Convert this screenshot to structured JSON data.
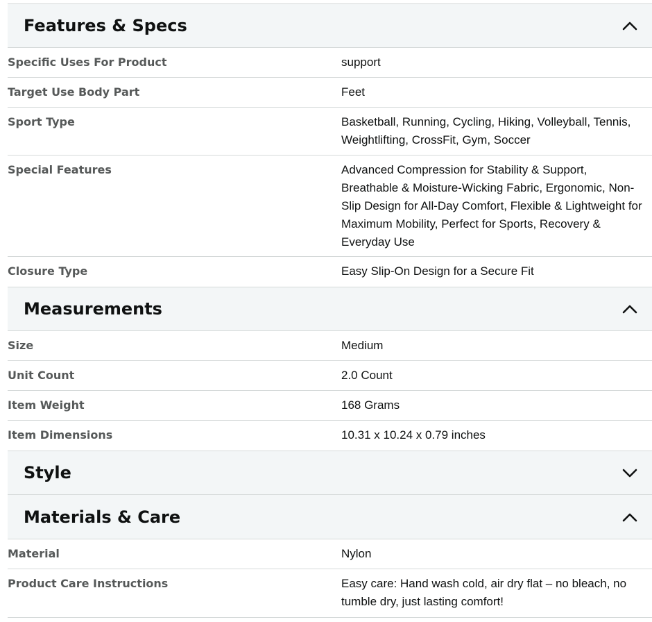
{
  "sections": [
    {
      "title": "Features & Specs",
      "expanded": true,
      "rows": [
        {
          "label": "Specific Uses For Product",
          "value": "support"
        },
        {
          "label": "Target Use Body Part",
          "value": "Feet"
        },
        {
          "label": "Sport Type",
          "value": "Basketball, Running, Cycling, Hiking, Volleyball, Tennis, Weightlifting, CrossFit, Gym, Soccer"
        },
        {
          "label": "Special Features",
          "value": "Advanced Compression for Stability & Support, Breathable & Moisture-Wicking Fabric, Ergonomic, Non-Slip Design for All-Day Comfort, Flexible & Lightweight for Maximum Mobility, Perfect for Sports, Recovery & Everyday Use"
        },
        {
          "label": "Closure Type",
          "value": "Easy Slip-On Design for a Secure Fit"
        }
      ]
    },
    {
      "title": "Measurements",
      "expanded": true,
      "rows": [
        {
          "label": "Size",
          "value": "Medium"
        },
        {
          "label": "Unit Count",
          "value": "2.0 Count"
        },
        {
          "label": "Item Weight",
          "value": "168 Grams"
        },
        {
          "label": "Item Dimensions",
          "value": "10.31 x 10.24 x 0.79 inches"
        }
      ]
    },
    {
      "title": "Style",
      "expanded": false,
      "rows": []
    },
    {
      "title": "Materials & Care",
      "expanded": true,
      "rows": [
        {
          "label": "Material",
          "value": "Nylon"
        },
        {
          "label": "Product Care Instructions",
          "value": "Easy care: Hand wash cold, air dry flat – no bleach, no tumble dry, just lasting comfort!"
        }
      ]
    }
  ],
  "icons": {
    "expanded": "chevron-up-icon",
    "collapsed": "chevron-down-icon"
  },
  "colors": {
    "header_bg": "#f3f6f7",
    "divider": "#d5d9d9",
    "label": "#565959",
    "text": "#0f1111"
  }
}
